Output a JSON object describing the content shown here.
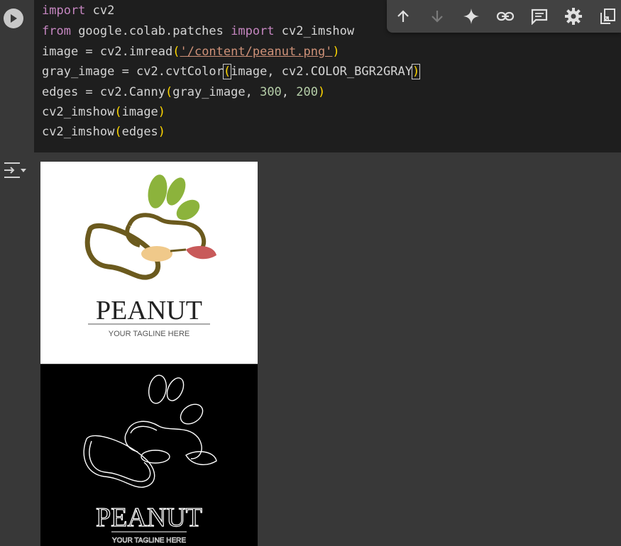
{
  "code": {
    "line1": {
      "kw": "import",
      "rest": " cv2"
    },
    "line2": {
      "kw1": "from",
      "mid": " google.colab.patches ",
      "kw2": "import",
      "rest": " cv2_imshow"
    },
    "line3": {
      "pre": "image = cv2.imread",
      "open": "(",
      "str": "'/content/peanut.png'",
      "close": ")"
    },
    "line4": {
      "pre": "gray_image = cv2.cvtColor",
      "open": "(",
      "mid": "image, cv2.COLOR_BGR2GRAY",
      "close": ")"
    },
    "line5": {
      "pre": "edges = cv2.Canny",
      "open": "(",
      "mid": "gray_image, ",
      "n1": "300",
      "sep": ", ",
      "n2": "200",
      "close": ")"
    },
    "line6": {
      "pre": "cv2_imshow",
      "open": "(",
      "mid": "image",
      "close": ")"
    },
    "line7": {
      "pre": "cv2_imshow",
      "open": "(",
      "mid": "edges",
      "close": ")"
    }
  },
  "toolbar": {
    "icons": [
      "arrow-up-icon",
      "arrow-down-icon",
      "sparkle-icon",
      "link-icon",
      "comment-icon",
      "gear-icon",
      "mirror-cell-icon"
    ]
  },
  "output": {
    "logo_text": "PEANUT",
    "tagline": "YOUR TAGLINE HERE",
    "edges_text": "PEANUT",
    "edges_tagline": "YOUR TAGLINE HERE"
  },
  "colors": {
    "code_bg": "#1e1e1e",
    "keyword": "#c586c0",
    "string": "#ce9178",
    "number": "#b5cea8",
    "paren": "#ffd700",
    "leaf_green": "#8cb33c",
    "peanut_brown": "#6b5a1e",
    "seed_tan": "#f0c98a",
    "seed_red": "#c85a5a"
  }
}
